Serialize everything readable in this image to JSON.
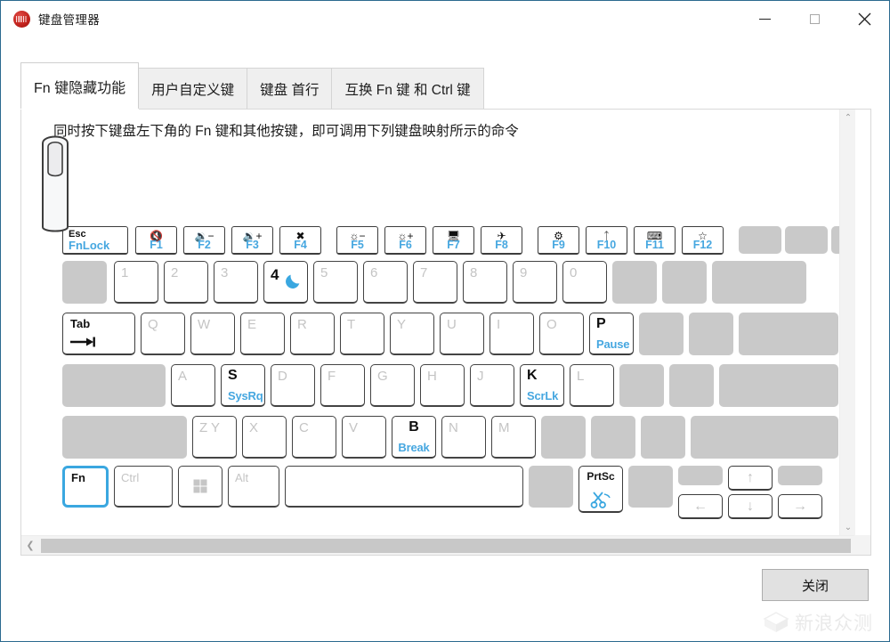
{
  "window": {
    "title": "键盘管理器",
    "logo_icon": "lenovo-logo-icon",
    "minimize_label": "minimize",
    "maximize_label": "maximize",
    "close_label": "close"
  },
  "tabs": [
    {
      "label": "Fn 键隐藏功能",
      "active": true
    },
    {
      "label": "用户自定义键",
      "active": false
    },
    {
      "label": "键盘 首行",
      "active": false
    },
    {
      "label": "互换 Fn 键 和 Ctrl 键",
      "active": false
    }
  ],
  "instruction": "同时按下键盘左下角的 Fn 键和其他按键，即可调用下列键盘映射所示的命令",
  "footer": {
    "close_button": "关闭",
    "watermark": "新浪众测"
  },
  "scrollbars": {
    "up_arrow": "⌃",
    "down_arrow": "⌄",
    "left_arrow": "❮",
    "right_arrow": "❯"
  },
  "keyboard": {
    "function_row": [
      {
        "name": "esc",
        "top": "Esc",
        "bottom": "FnLock",
        "style": "esc"
      },
      {
        "name": "f1",
        "icon": "🔇",
        "icon_name": "mute-icon",
        "label": "F1"
      },
      {
        "name": "f2",
        "icon": "🔉",
        "icon_name": "volume-down-icon",
        "label": "F2"
      },
      {
        "name": "f3",
        "icon": "🔊",
        "icon_name": "volume-up-icon",
        "label": "F3"
      },
      {
        "name": "f4",
        "icon": "✗",
        "icon_name": "mic-mute-icon",
        "label": "F4"
      },
      {
        "name": "f5",
        "icon": "☀−",
        "icon_name": "brightness-down-icon",
        "label": "F5"
      },
      {
        "name": "f6",
        "icon": "☀+",
        "icon_name": "brightness-up-icon",
        "label": "F6"
      },
      {
        "name": "f7",
        "icon": "🖵",
        "icon_name": "projector-icon",
        "label": "F7"
      },
      {
        "name": "f8",
        "icon": "✈",
        "icon_name": "airplane-mode-icon",
        "label": "F8"
      },
      {
        "name": "f9",
        "icon": "⚙",
        "icon_name": "settings-gear-icon",
        "label": "F9"
      },
      {
        "name": "f10",
        "icon": "⌁",
        "icon_name": "bluetooth-icon",
        "label": "F10"
      },
      {
        "name": "f11",
        "icon": "⌨",
        "icon_name": "keyboard-icon",
        "label": "F11"
      },
      {
        "name": "f12",
        "icon": "☆",
        "icon_name": "favorite-star-icon",
        "label": "F12"
      }
    ],
    "mapped_keys": [
      {
        "name": "key-4-sleep",
        "letter": "4",
        "icon_name": "moon-sleep-icon"
      },
      {
        "name": "key-tab",
        "letter": "Tab",
        "icon_name": "tab-arrow-icon"
      },
      {
        "name": "key-p-pause",
        "letter": "P",
        "sub": "Pause"
      },
      {
        "name": "key-s-sysrq",
        "letter": "S",
        "sub": "SysRq"
      },
      {
        "name": "key-k-scrlk",
        "letter": "K",
        "sub": "ScrLk"
      },
      {
        "name": "key-b-break",
        "letter": "B",
        "sub": "Break"
      },
      {
        "name": "key-prtsc",
        "letter": "PrtSc",
        "icon_name": "snipping-tool-icon"
      },
      {
        "name": "key-fn",
        "letter": "Fn",
        "highlighted": true
      }
    ],
    "number_row": [
      "1",
      "2",
      "3",
      "4",
      "5",
      "6",
      "7",
      "8",
      "9",
      "0"
    ],
    "qwerty_row": [
      "Q",
      "W",
      "E",
      "R",
      "T",
      "Y",
      "U",
      "I",
      "O",
      "P"
    ],
    "asdf_row": [
      "A",
      "S",
      "D",
      "F",
      "G",
      "H",
      "J",
      "K",
      "L"
    ],
    "zxcv_row": [
      "Z Y",
      "X",
      "C",
      "V",
      "B",
      "N",
      "M"
    ],
    "bottom_row": [
      "Fn",
      "Ctrl",
      "Win",
      "Alt",
      "Space"
    ],
    "arrow_keys": [
      "↑",
      "←",
      "↓",
      "→"
    ]
  },
  "colors": {
    "accent_blue": "#46a7e0",
    "highlight_blue": "#3aa7e0",
    "dim_key": "#c9c9c9",
    "window_border": "#2b6a8f",
    "logo_red": "#c0211c"
  }
}
